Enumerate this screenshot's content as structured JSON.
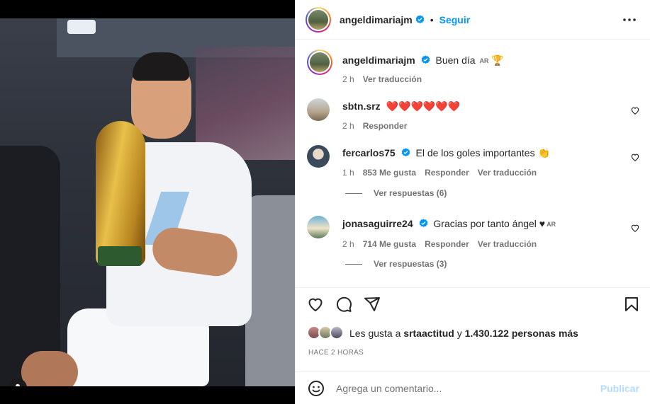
{
  "post": {
    "author": "angeldimariajm",
    "follow_label": "Seguir",
    "separator": "•"
  },
  "caption": {
    "username": "angeldimariajm",
    "text": "Buen día",
    "flag": "AR",
    "emoji": "🏆",
    "time": "2 h",
    "translate": "Ver traducción"
  },
  "comments": [
    {
      "username": "sbtn.srz",
      "text": "❤️❤️❤️❤️❤️❤️",
      "time": "2 h",
      "reply": "Responder"
    },
    {
      "username": "fercarlos75",
      "text": "El de los goles importantes 👏",
      "time": "1 h",
      "likes": "853 Me gusta",
      "reply": "Responder",
      "translate": "Ver traducción",
      "view_replies": "Ver respuestas (6)"
    },
    {
      "username": "jonasaguirre24",
      "text": "Gracias por tanto ángel ♥",
      "flag": "AR",
      "time": "2 h",
      "likes": "714 Me gusta",
      "reply": "Responder",
      "translate": "Ver traducción",
      "view_replies": "Ver respuestas (3)"
    }
  ],
  "likes": {
    "prefix": "Les gusta a",
    "user": "srtaactitud",
    "connector": "y",
    "count": "1.430.122 personas más"
  },
  "timestamp": "HACE 2 HORAS",
  "composer": {
    "placeholder": "Agrega un comentario...",
    "publish": "Publicar"
  },
  "colors": {
    "link_blue": "#0095f6",
    "publish_disabled": "#b3dbff",
    "muted": "#737373",
    "text": "#262626",
    "heart_red": "#ed1c3a"
  },
  "icons": [
    "more-options-icon",
    "verified-badge-icon",
    "heart-icon",
    "comment-icon",
    "share-icon",
    "bookmark-icon",
    "emoji-icon",
    "user-tag-icon"
  ]
}
